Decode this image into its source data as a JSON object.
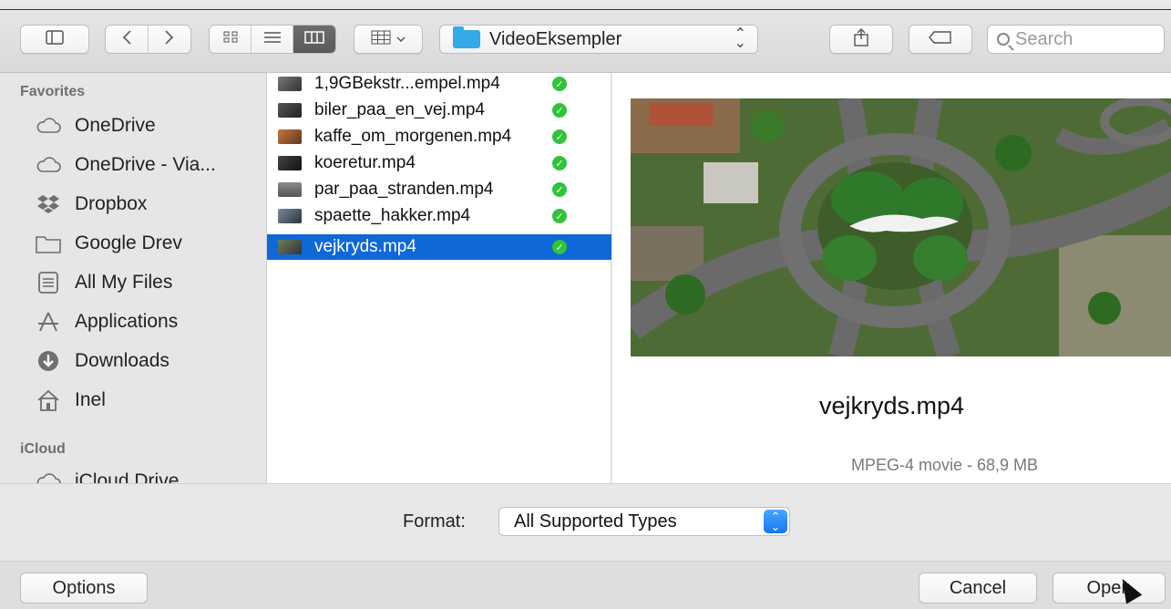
{
  "toolbar": {
    "view_icon_sidebar": "sidebar-icon",
    "back_icon": "chevron-left-icon",
    "forward_icon": "chevron-right-icon",
    "view_modes": [
      "icon-view",
      "list-view",
      "column-view"
    ],
    "arrange_icon": "grid-icon",
    "location": "VideoEksempler",
    "share_icon": "share-icon",
    "tag_icon": "tag-icon",
    "search_placeholder": "Search"
  },
  "sidebar": {
    "favorites_header": "Favorites",
    "favorites": [
      {
        "label": "OneDrive",
        "icon": "cloud-icon"
      },
      {
        "label": "OneDrive - Via...",
        "icon": "cloud-icon"
      },
      {
        "label": "Dropbox",
        "icon": "dropbox-icon"
      },
      {
        "label": "Google Drev",
        "icon": "folder-icon"
      },
      {
        "label": "All My Files",
        "icon": "files-icon"
      },
      {
        "label": "Applications",
        "icon": "applications-icon"
      },
      {
        "label": "Downloads",
        "icon": "download-icon"
      },
      {
        "label": "Inel",
        "icon": "home-icon"
      }
    ],
    "icloud_header": "iCloud",
    "icloud": [
      {
        "label": "iCloud Drive",
        "icon": "cloud-icon"
      }
    ]
  },
  "files": [
    {
      "name": "1,9GBekstr...empel.mp4",
      "status": "synced"
    },
    {
      "name": "biler_paa_en_vej.mp4",
      "status": "synced"
    },
    {
      "name": "kaffe_om_morgenen.mp4",
      "status": "synced"
    },
    {
      "name": "koeretur.mp4",
      "status": "synced"
    },
    {
      "name": "par_paa_stranden.mp4",
      "status": "synced"
    },
    {
      "name": "spaette_hakker.mp4",
      "status": "synced"
    },
    {
      "name": "vejkryds.mp4",
      "status": "synced",
      "selected": true
    }
  ],
  "preview": {
    "file_name": "vejkryds.mp4",
    "info": "MPEG-4 movie - 68,9 MB"
  },
  "format": {
    "label": "Format:",
    "selected": "All Supported Types"
  },
  "buttons": {
    "options": "Options",
    "cancel": "Cancel",
    "open": "Open"
  },
  "colors": {
    "selection": "#0f68d8",
    "sync_check": "#2fc43a",
    "folder_blue": "#35a8e6",
    "stepper_blue": "#1477ee"
  }
}
